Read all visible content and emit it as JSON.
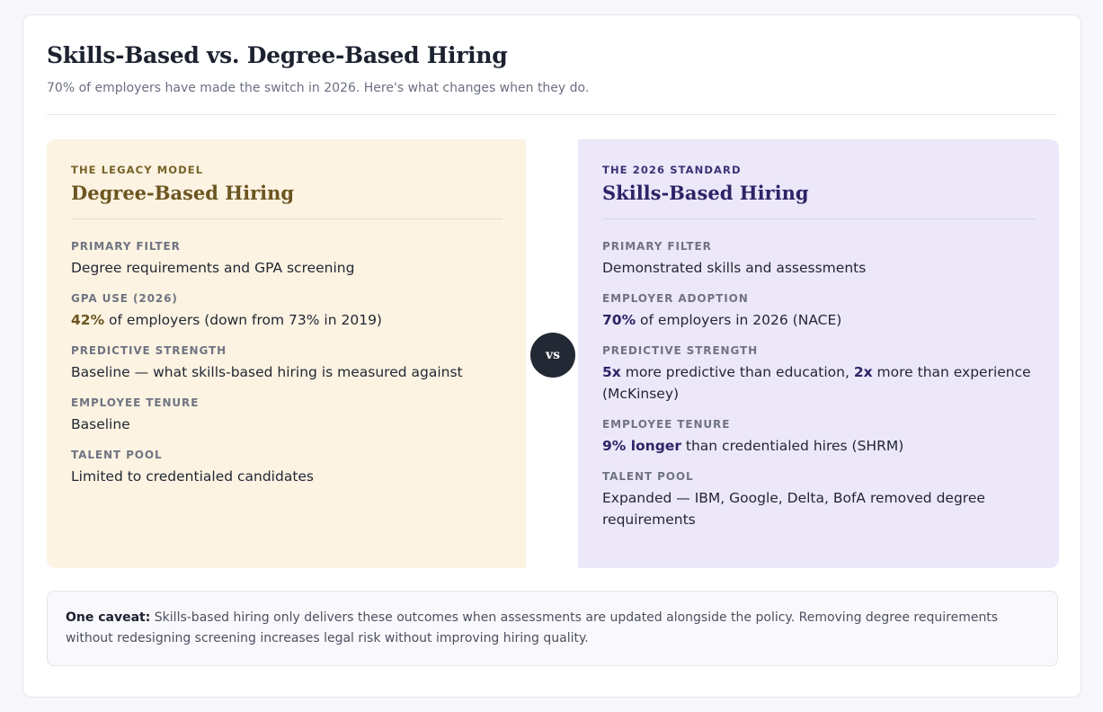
{
  "header": {
    "title": "Skills-Based vs. Degree-Based Hiring",
    "subtitle": "70% of employers have made the switch in 2026. Here's what changes when they do."
  },
  "legacy": {
    "eyebrow": "THE LEGACY MODEL",
    "title": "Degree-Based Hiring",
    "accent_color": "#6c5520",
    "background_color": "#fcf3e2",
    "rows": [
      {
        "label": "PRIMARY FILTER",
        "value": "Degree requirements and GPA screening"
      },
      {
        "label": "GPA USE (2026)",
        "em": "42%",
        "value": " of employers (down from 73% in 2019)"
      },
      {
        "label": "PREDICTIVE STRENGTH",
        "value": "Baseline — what skills-based hiring is measured against"
      },
      {
        "label": "EMPLOYEE TENURE",
        "value": "Baseline"
      },
      {
        "label": "TALENT POOL",
        "value": "Limited to credentialed candidates"
      }
    ]
  },
  "vs_badge": "vs",
  "skills": {
    "eyebrow": "THE 2026 STANDARD",
    "title": "Skills-Based Hiring",
    "accent_color": "#2c2466",
    "background_color": "#ece8fa",
    "rows": [
      {
        "label": "PRIMARY FILTER",
        "value": "Demonstrated skills and assessments"
      },
      {
        "label": "EMPLOYER ADOPTION",
        "em": "70%",
        "value": " of employers in 2026 (NACE)"
      },
      {
        "label": "PREDICTIVE STRENGTH",
        "em": "5x",
        "value": " more predictive than education, ",
        "em2": "2x",
        "value2": " more than experience (McKinsey)"
      },
      {
        "label": "EMPLOYEE TENURE",
        "em": "9% longer",
        "value": " than credentialed hires (SHRM)"
      },
      {
        "label": "TALENT POOL",
        "value": "Expanded — IBM, Google, Delta, BofA removed degree requirements"
      }
    ]
  },
  "caveat": {
    "lead": "One caveat:",
    "text": " Skills-based hiring only delivers these outcomes when assessments are updated alongside the policy. Removing degree requirements without redesigning screening increases legal risk without improving hiring quality."
  }
}
